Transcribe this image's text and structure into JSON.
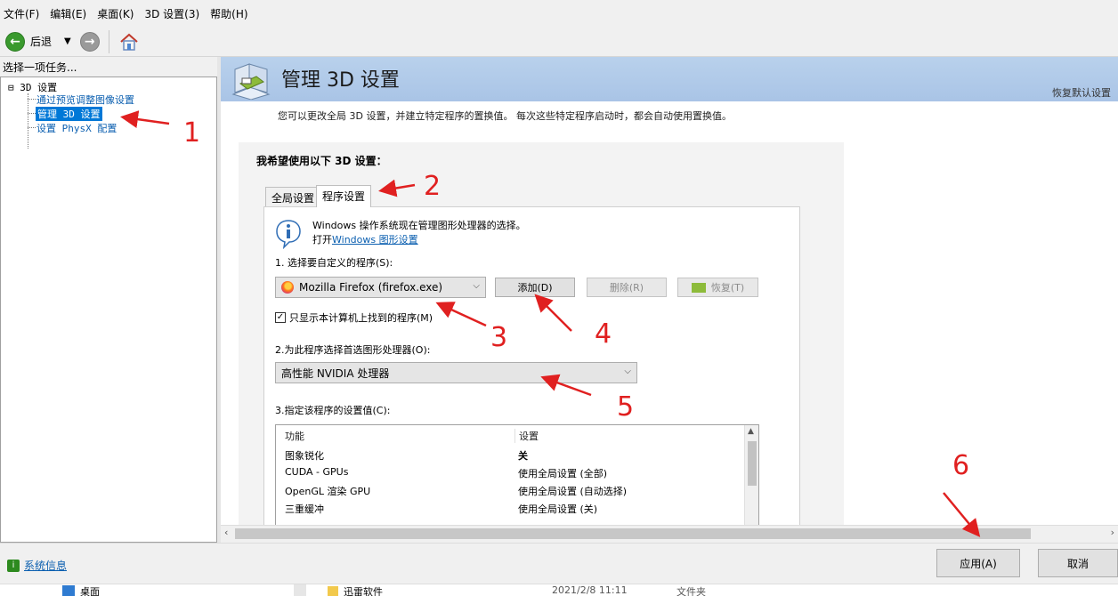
{
  "menu": [
    "文件(F)",
    "编辑(E)",
    "桌面(K)",
    "3D 设置(3)",
    "帮助(H)"
  ],
  "toolbar": {
    "back_label": "后退"
  },
  "left": {
    "header": "选择一项任务...",
    "tree_root": "⊟ 3D 设置",
    "items": [
      "通过预览调整图像设置",
      "管理 3D 设置",
      "设置 PhysX 配置"
    ]
  },
  "banner": {
    "title": "管理 3D 设置",
    "restore": "恢复默认设置"
  },
  "description": "您可以更改全局 3D 设置，并建立特定程序的置换值。 每次这些特定程序启动时，都会自动使用置换值。",
  "group_title": "我希望使用以下 3D 设置：",
  "tabs": [
    "全局设置",
    "程序设置"
  ],
  "info": {
    "line1": "Windows 操作系统现在管理图形处理器的选择。",
    "line2_prefix": "打开",
    "line2_link": "Windows 图形设置"
  },
  "step1": {
    "label": "1. 选择要自定义的程序(S):",
    "program": "Mozilla Firefox (firefox.exe)",
    "add": "添加(D)",
    "remove": "删除(R)",
    "restore": "恢复(T)",
    "checkbox_label": "只显示本计算机上找到的程序(M)",
    "checkbox_mark": "✓"
  },
  "step2": {
    "label": "2.为此程序选择首选图形处理器(O):",
    "value": "高性能 NVIDIA 处理器"
  },
  "step3": {
    "label": "3.指定该程序的设置值(C):",
    "col_feature": "功能",
    "col_setting": "设置",
    "rows": [
      {
        "feature": "图象锐化",
        "setting": "关"
      },
      {
        "feature": "CUDA - GPUs",
        "setting": "使用全局设置 (全部)"
      },
      {
        "feature": "OpenGL 渲染 GPU",
        "setting": "使用全局设置 (自动选择)"
      },
      {
        "feature": "三重缓冲",
        "setting": "使用全局设置 (关)"
      }
    ]
  },
  "footer": {
    "sysinfo": "系统信息",
    "apply": "应用(A)",
    "cancel": "取消"
  },
  "bg": {
    "desktop": "桌面",
    "folder": "迅雷软件",
    "date": "2021/2/8 11:11",
    "type": "文件夹"
  },
  "annotations": [
    "1",
    "2",
    "3",
    "4",
    "5",
    "6"
  ],
  "colors": {
    "annotation": "#e02020",
    "selection": "#0078d7",
    "link": "#0b5fb0",
    "banner": "#b9d1ec"
  }
}
